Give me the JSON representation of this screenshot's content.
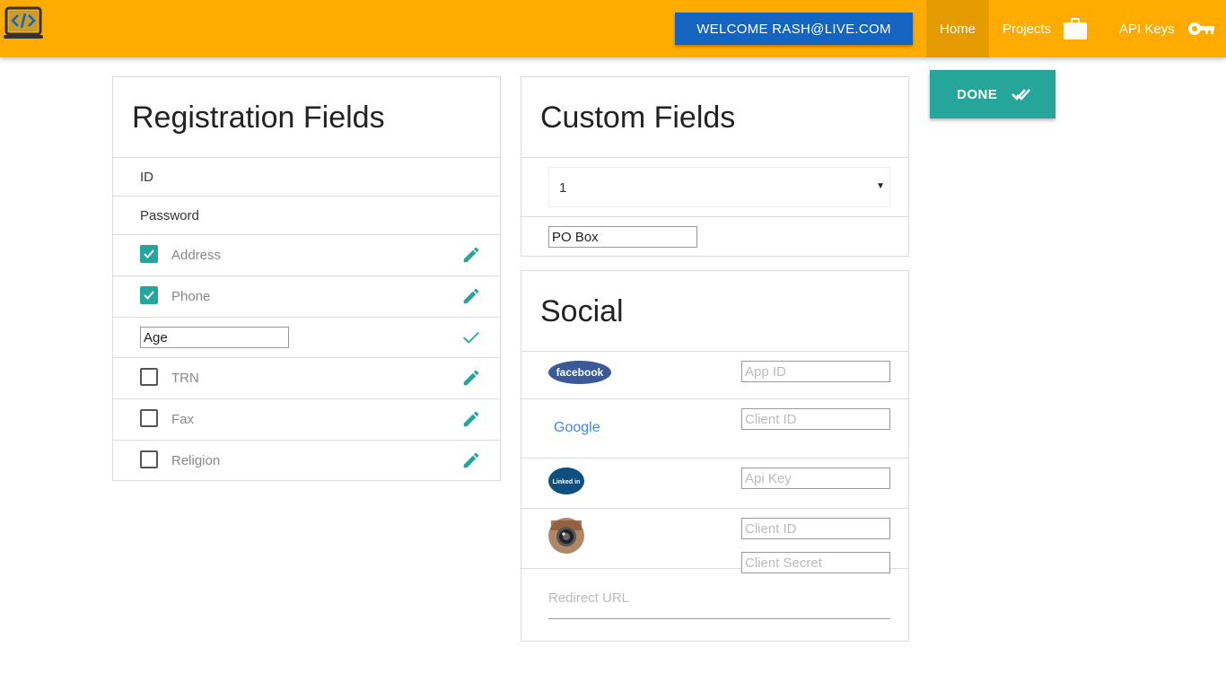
{
  "header": {
    "welcome_label": "WELCOME RASH@LIVE.COM",
    "nav": {
      "home": "Home",
      "projects": "Projects",
      "api_keys": "API Keys"
    },
    "colors": {
      "bar": "#ffab00",
      "active": "#e49b00",
      "welcome": "#1565c0"
    }
  },
  "registration": {
    "title": "Registration Fields",
    "fixed_fields": [
      "ID",
      "Password"
    ],
    "fields": [
      {
        "label": "Address",
        "checked": true
      },
      {
        "label": "Phone",
        "checked": true
      },
      {
        "label": "Age",
        "editing": true
      },
      {
        "label": "TRN",
        "checked": false
      },
      {
        "label": "Fax",
        "checked": false
      },
      {
        "label": "Religion",
        "checked": false
      }
    ]
  },
  "custom": {
    "title": "Custom Fields",
    "select_value": "1",
    "field_value": "PO Box"
  },
  "social": {
    "title": "Social",
    "facebook": {
      "logo": "facebook",
      "placeholder": "App ID"
    },
    "google": {
      "logo": "Google",
      "placeholder": "Client ID"
    },
    "linkedin": {
      "logo": "Linked in",
      "placeholder": "Api Key"
    },
    "instagram": {
      "logo": "instagram-icon",
      "placeholder_id": "Client ID",
      "placeholder_secret": "Client Secret"
    },
    "redirect_label": "Redirect URL"
  },
  "done_label": "DONE",
  "accent": "#26a69a"
}
